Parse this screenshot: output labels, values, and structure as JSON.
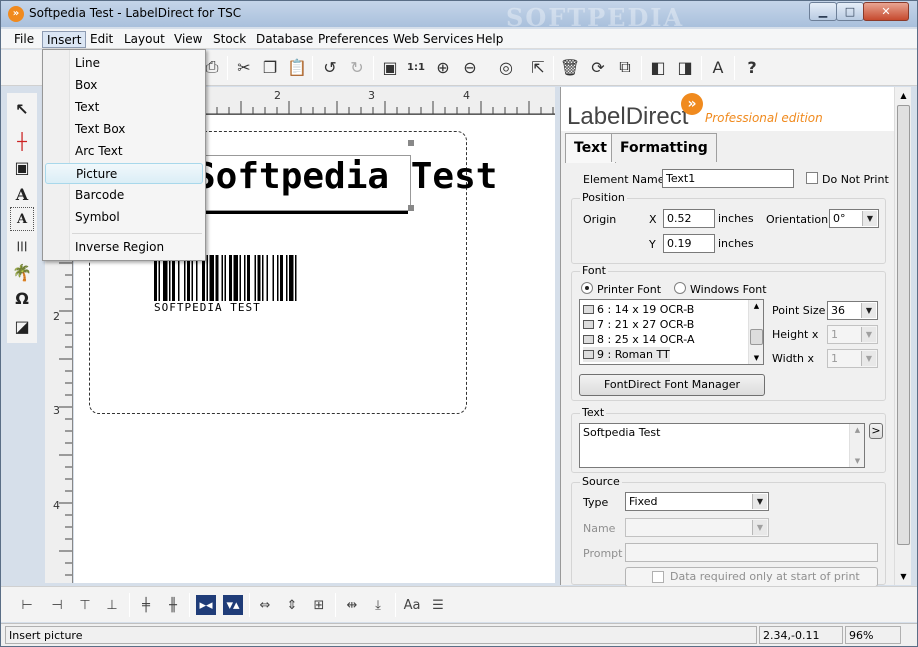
{
  "window": {
    "title": "Softpedia Test - LabelDirect for TSC",
    "watermark": "SOFTPEDIA"
  },
  "menubar": [
    "File",
    "Insert",
    "Edit",
    "Layout",
    "View",
    "Stock",
    "Database",
    "Preferences",
    "Web Services",
    "Help"
  ],
  "insert_menu": {
    "items": [
      "Line",
      "Box",
      "Text",
      "Text Box",
      "Arc Text",
      "Picture",
      "Barcode",
      "Symbol"
    ],
    "extra": "Inverse Region",
    "highlighted": "Picture"
  },
  "ruler": {
    "h_labels": [
      "2",
      "3",
      "4"
    ],
    "v_labels": [
      "2",
      "3",
      "4"
    ]
  },
  "canvas": {
    "text_object": "Softpedia Test",
    "barcode_text": "SOFTPEDIA TEST"
  },
  "panel": {
    "logo_main": "LabelDirect",
    "logo_sub": "Professional edition",
    "tabs": [
      "Text",
      "Formatting"
    ],
    "element_name_label": "Element Name",
    "element_name": "Text1",
    "do_not_print_label": "Do Not Print",
    "position": {
      "title": "Position",
      "origin_label": "Origin",
      "x_label": "X",
      "x_value": "0.52",
      "y_label": "Y",
      "y_value": "0.19",
      "units": "inches",
      "orientation_label": "Orientation",
      "orientation_value": "0°"
    },
    "font": {
      "title": "Font",
      "printer_font_label": "Printer Font",
      "windows_font_label": "Windows Font",
      "list": [
        "6 : 14 x 19 OCR-B",
        "7 : 21 x 27 OCR-B",
        "8 : 25 x 14 OCR-A",
        "9 : Roman TT"
      ],
      "point_size_label": "Point Size",
      "point_size_value": "36",
      "height_label": "Height x",
      "height_value": "1",
      "width_label": "Width x",
      "width_value": "1",
      "manager_button": "FontDirect Font Manager"
    },
    "text_group": {
      "title": "Text",
      "value": "Softpedia Test",
      "expand_button": ">"
    },
    "source": {
      "title": "Source",
      "type_label": "Type",
      "type_value": "Fixed",
      "name_label": "Name",
      "prompt_label": "Prompt",
      "data_required_label": "Data required only at start of print run"
    }
  },
  "statusbar": {
    "message": "Insert picture",
    "coords": "2.34,-0.11",
    "zoom": "96%"
  }
}
